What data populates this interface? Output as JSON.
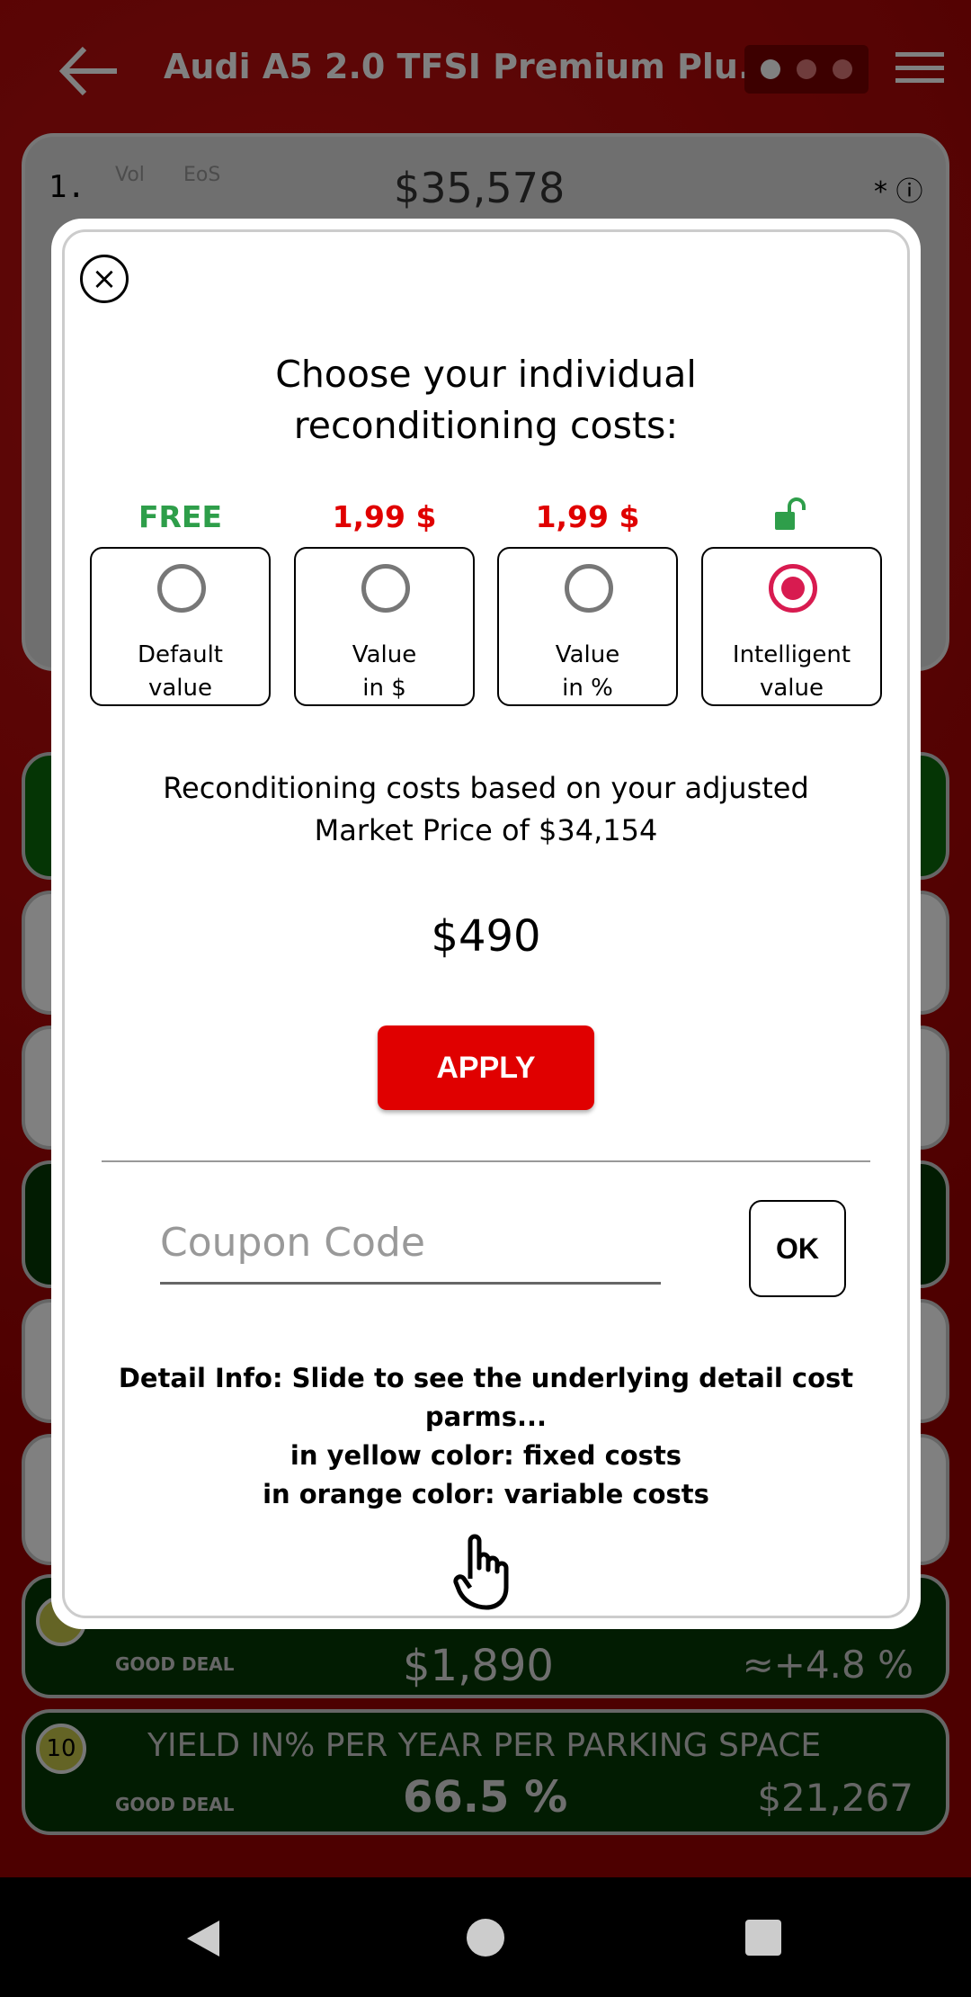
{
  "header": {
    "title": "Audi A5 2.0 TFSI Premium Plu...",
    "back_icon": "arrow-left-icon",
    "menu_icon": "hamburger-icon"
  },
  "background_card": {
    "index": "1.",
    "vol_label": "Vol",
    "eos_label": "EoS",
    "price": "$35,578",
    "asterisk": "*"
  },
  "background_rows": [
    {
      "badge": "",
      "label": "GOOD DEAL",
      "value": "$1,890",
      "right": "≈+4.8 %"
    },
    {
      "badge": "10",
      "title": "YIELD IN% PER YEAR PER PARKING SPACE",
      "label": "GOOD DEAL",
      "value": "66.5 %",
      "right": "$21,267"
    }
  ],
  "dialog": {
    "title": "Choose your individual reconditioning costs:",
    "options": [
      {
        "price": "FREE",
        "price_color": "#2e9e4a",
        "label1": "Default",
        "label2": "value",
        "selected": false
      },
      {
        "price": "1,99 $",
        "price_color": "#e00000",
        "label1": "Value",
        "label2": "in $",
        "selected": false
      },
      {
        "price": "1,99 $",
        "price_color": "#e00000",
        "label1": "Value",
        "label2": "in %",
        "selected": false
      },
      {
        "price_icon": "unlocked-padlock-icon",
        "price_color": "#2e9e4a",
        "label1": "Intelligent",
        "label2": "value",
        "selected": true
      }
    ],
    "basis_line1": "Reconditioning costs based on your adjusted",
    "basis_line2": "Market Price of $34,154",
    "amount": "$490",
    "apply_label": "APPLY",
    "coupon_placeholder": "Coupon Code",
    "ok_label": "OK",
    "detail_line1": "Detail Info: Slide to see the underlying detail cost",
    "detail_line2": "parms...",
    "detail_line3": "in yellow color: fixed costs",
    "detail_line4": "in orange color: variable costs"
  },
  "colors": {
    "accent": "#e00000",
    "selected_radio": "#d81b50",
    "free": "#2e9e4a"
  }
}
